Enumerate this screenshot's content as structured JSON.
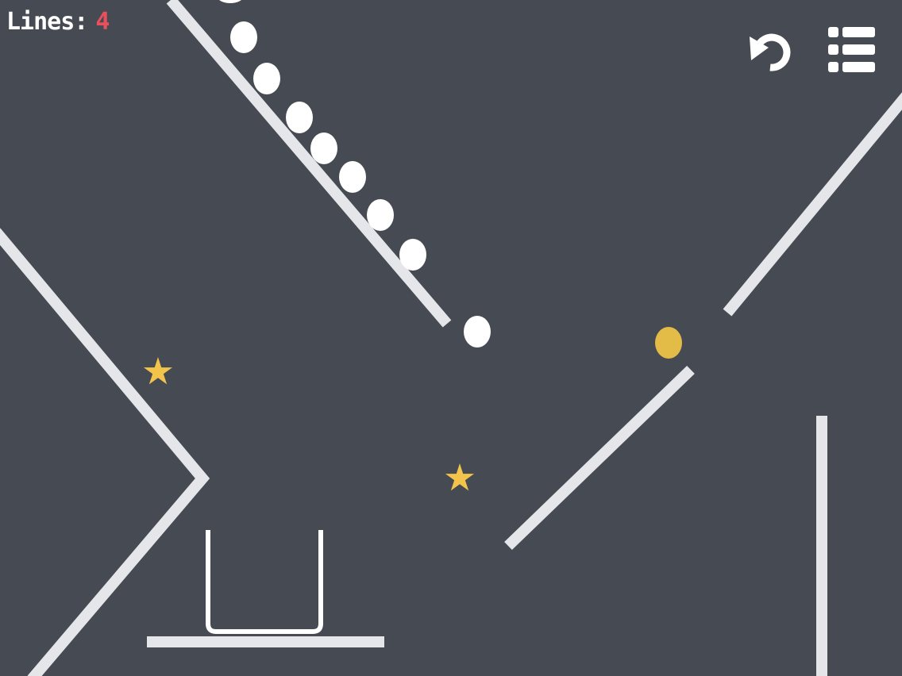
{
  "hud": {
    "lines_label": "Lines:",
    "lines_count": "4"
  },
  "toolbar": {
    "restart_icon": "restart-icon",
    "menu_icon": "level-menu-icon"
  },
  "colors": {
    "background": "#464a52",
    "walls": "#e4e6ea",
    "balls": "#ffffff",
    "gold_ball": "#e3bb47",
    "star": "#f3c44c",
    "lines_count": "#e8505b"
  },
  "scene": {
    "ball_count": 10,
    "gold_ball_count": 1,
    "star_count": 2,
    "cup_count": 1
  }
}
